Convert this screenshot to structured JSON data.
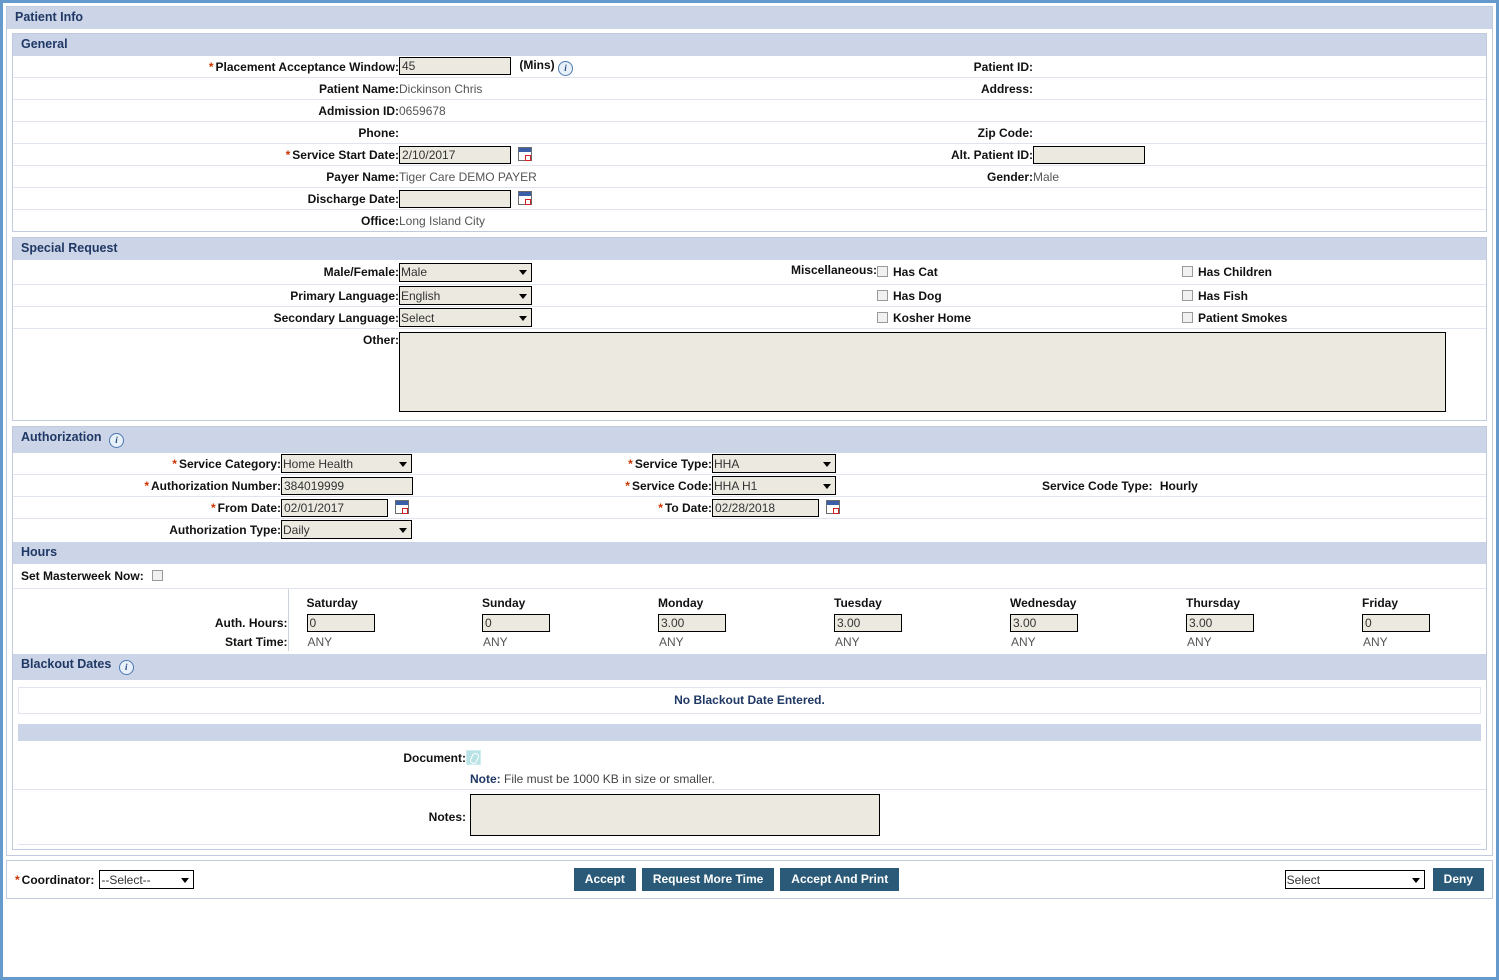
{
  "window": {
    "title": "Patient Info"
  },
  "general": {
    "title": "General",
    "placement_label": "Placement Acceptance Window:",
    "placement_value": "45",
    "placement_unit": "(Mins)",
    "info_icon": "info-icon",
    "patient_name_label": "Patient Name:",
    "patient_name_value": "Dickinson Chris",
    "admission_id_label": "Admission ID:",
    "admission_id_value": "0659678",
    "phone_label": "Phone:",
    "phone_value": "",
    "service_start_label": "Service Start Date:",
    "service_start_value": "2/10/2017",
    "payer_name_label": "Payer Name:",
    "payer_name_value": "Tiger Care DEMO PAYER",
    "discharge_date_label": "Discharge Date:",
    "discharge_date_value": "",
    "office_label": "Office:",
    "office_value": "Long Island City",
    "patient_id_label": "Patient ID:",
    "patient_id_value": "",
    "address_label": "Address:",
    "address_value": "",
    "zip_label": "Zip Code:",
    "zip_value": "",
    "alt_patient_id_label": "Alt. Patient ID:",
    "alt_patient_id_value": "",
    "gender_label": "Gender:",
    "gender_value": "Male"
  },
  "special_request": {
    "title": "Special Request",
    "male_female_label": "Male/Female:",
    "male_female_value": "Male",
    "primary_language_label": "Primary Language:",
    "primary_language_value": "English",
    "secondary_language_label": "Secondary Language:",
    "secondary_language_value": "Select",
    "other_label": "Other:",
    "other_value": "",
    "misc_label": "Miscellaneous:",
    "misc": [
      {
        "label": "Has Cat",
        "checked": false
      },
      {
        "label": "Has Children",
        "checked": false
      },
      {
        "label": "Has Dog",
        "checked": false
      },
      {
        "label": "Has Fish",
        "checked": false
      },
      {
        "label": "Kosher Home",
        "checked": false
      },
      {
        "label": "Patient Smokes",
        "checked": false
      }
    ]
  },
  "authorization": {
    "title": "Authorization",
    "service_category_label": "Service Category:",
    "service_category_value": "Home Health",
    "auth_number_label": "Authorization Number:",
    "auth_number_value": "384019999",
    "from_date_label": "From Date:",
    "from_date_value": "02/01/2017",
    "auth_type_label": "Authorization Type:",
    "auth_type_value": "Daily",
    "service_type_label": "Service Type:",
    "service_type_value": "HHA",
    "service_code_label": "Service Code:",
    "service_code_value": "HHA H1",
    "service_code_type_label": "Service Code Type:",
    "service_code_type_value": "Hourly",
    "to_date_label": "To Date:",
    "to_date_value": "02/28/2018"
  },
  "hours": {
    "title": "Hours",
    "masterweek_label": "Set Masterweek Now:",
    "masterweek_checked": false,
    "auth_hours_label": "Auth. Hours:",
    "start_time_label": "Start Time:",
    "days": [
      {
        "name": "Saturday",
        "hours": "0",
        "start": "ANY"
      },
      {
        "name": "Sunday",
        "hours": "0",
        "start": "ANY"
      },
      {
        "name": "Monday",
        "hours": "3.00",
        "start": "ANY"
      },
      {
        "name": "Tuesday",
        "hours": "3.00",
        "start": "ANY"
      },
      {
        "name": "Wednesday",
        "hours": "3.00",
        "start": "ANY"
      },
      {
        "name": "Thursday",
        "hours": "3.00",
        "start": "ANY"
      },
      {
        "name": "Friday",
        "hours": "0",
        "start": "ANY"
      }
    ]
  },
  "blackout": {
    "title": "Blackout Dates",
    "empty_message": "No Blackout Date Entered."
  },
  "document": {
    "label": "Document:",
    "clip_icon": "paperclip-icon",
    "note_prefix": "Note:",
    "note_text": "File must be 1000 KB in size or smaller.",
    "notes_label": "Notes:",
    "notes_value": ""
  },
  "footer": {
    "coordinator_label": "Coordinator:",
    "coordinator_value": "--Select--",
    "accept_label": "Accept",
    "request_more_time_label": "Request More Time",
    "accept_and_print_label": "Accept And Print",
    "deny_reason_value": "Select",
    "deny_label": "Deny"
  },
  "colors": {
    "header_bar": "#ccd4e8",
    "header_text": "#1f3864",
    "button": "#2b5a78",
    "required": "#cc3300",
    "page_border": "#6699cc"
  }
}
